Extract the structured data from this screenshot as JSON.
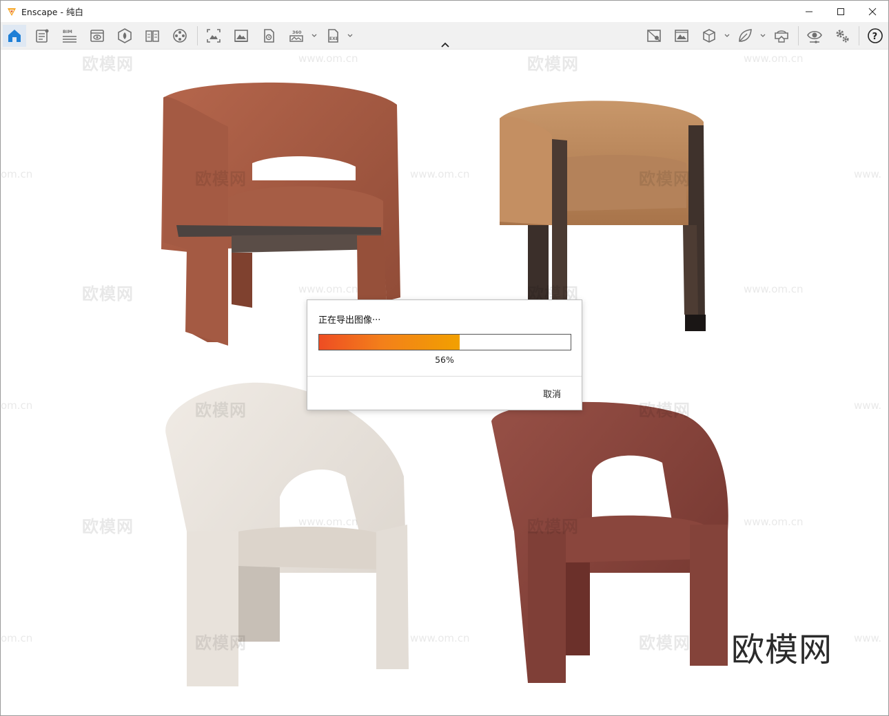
{
  "window": {
    "app_name": "Enscape",
    "separator": " - ",
    "document_name": "纯白",
    "controls": {
      "minimize_icon": "minimize-icon",
      "maximize_icon": "maximize-icon",
      "close_icon": "close-icon"
    }
  },
  "toolbar": {
    "left_icons": [
      "home-icon",
      "notes-icon",
      "bim-icon",
      "views-icon",
      "asset-library-icon",
      "material-book-icon",
      "video-editor-icon"
    ],
    "middle_icons": [
      "screenshot-icon",
      "batch-render-icon",
      "render-settings-icon",
      "panorama-360-icon",
      "export-exe-icon"
    ],
    "bim_label": "BIM",
    "panorama_label": "360",
    "exe_label": "EXE",
    "right_icons": [
      "atmosphere-icon",
      "render-image-icon",
      "cube-view-icon",
      "leaf-icon",
      "vr-headset-icon",
      "visual-settings-icon",
      "general-settings-icon",
      "help-icon"
    ],
    "help_label": "?",
    "accent_color": "#1e7fd6"
  },
  "viewport": {
    "watermark_cn": "欧模网",
    "watermark_url": "www.om.cn",
    "watermark_url_partial_left": "om.cn",
    "watermark_url_partial_right": "www.",
    "logo_text": "欧模网"
  },
  "dialog": {
    "title": "正在导出图像···",
    "progress_fraction": 0.56,
    "progress_label": "56%",
    "cancel_label": "取消"
  }
}
